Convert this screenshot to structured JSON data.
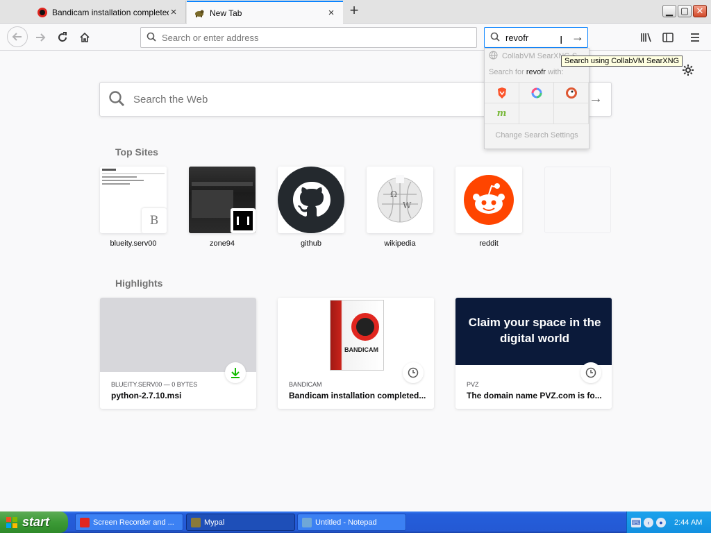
{
  "tabs": [
    {
      "title": "Bandicam installation completed su",
      "close": "×"
    },
    {
      "title": "New Tab",
      "close": "×"
    }
  ],
  "new_tab": "+",
  "window_buttons": [
    "▁",
    "▢",
    "✕"
  ],
  "navbar": {
    "url_placeholder": "Search or enter address",
    "search_value": "revofr",
    "search_go": "→",
    "icons": [
      "back-icon",
      "forward-icon",
      "reload-icon",
      "home-icon",
      "library-icon",
      "sidebar-icon",
      "menu-icon"
    ]
  },
  "search_popup": {
    "suggestion": "CollabVM SearXNG S",
    "search_for_prefix": "Search for ",
    "search_for_term": "revofr",
    "search_for_suffix": " with:",
    "engines": [
      {
        "name": "brave",
        "glyph": "🛡",
        "color": "#fb542b"
      },
      {
        "name": "qwant",
        "glyph": "Q",
        "color": "#5c97ff"
      },
      {
        "name": "duckduckgo",
        "glyph": "D",
        "color": "#de5833"
      },
      {
        "name": "mojeek",
        "glyph": "m",
        "color": "#7ab93c"
      }
    ],
    "change_settings": "Change Search Settings"
  },
  "tooltip": "Search using CollabVM SearXNG",
  "content": {
    "web_search_placeholder": "Search the Web",
    "web_search_go": "→",
    "top_sites_title": "Top Sites",
    "highlights_title": "Highlights",
    "top_sites": [
      {
        "label": "blueity.serv00",
        "badge": "B"
      },
      {
        "label": "zone94"
      },
      {
        "label": "github"
      },
      {
        "label": "wikipedia"
      },
      {
        "label": "reddit"
      },
      {
        "label": ""
      }
    ],
    "highlights": [
      {
        "context": "BLUEITY.SERV00 — 0 BYTES",
        "title": "python-2.7.10.msi",
        "badge": "download-icon"
      },
      {
        "context": "BANDICAM",
        "title": "Bandicam installation completed...",
        "badge": "clock-icon",
        "thumb_text": "BANDICAM"
      },
      {
        "context": "PVZ",
        "title": "The domain name PVZ.com is fo...",
        "badge": "clock-icon",
        "thumb_text": "Claim your space in the digital world"
      }
    ]
  },
  "taskbar": {
    "start_label": "start",
    "tasks": [
      {
        "label": "Screen Recorder and ...",
        "color": "#e0261f"
      },
      {
        "label": "Mypal",
        "color": "#8a7a3a"
      },
      {
        "label": "Untitled - Notepad",
        "color": "#6fa7d8"
      }
    ],
    "clock": "2:44 AM"
  },
  "colors": {
    "accent": "#0a84ff",
    "taskbar": "#245edb",
    "start": "#3c9a36",
    "pvz_bg": "#0b1a3a",
    "reddit": "#ff4500"
  }
}
